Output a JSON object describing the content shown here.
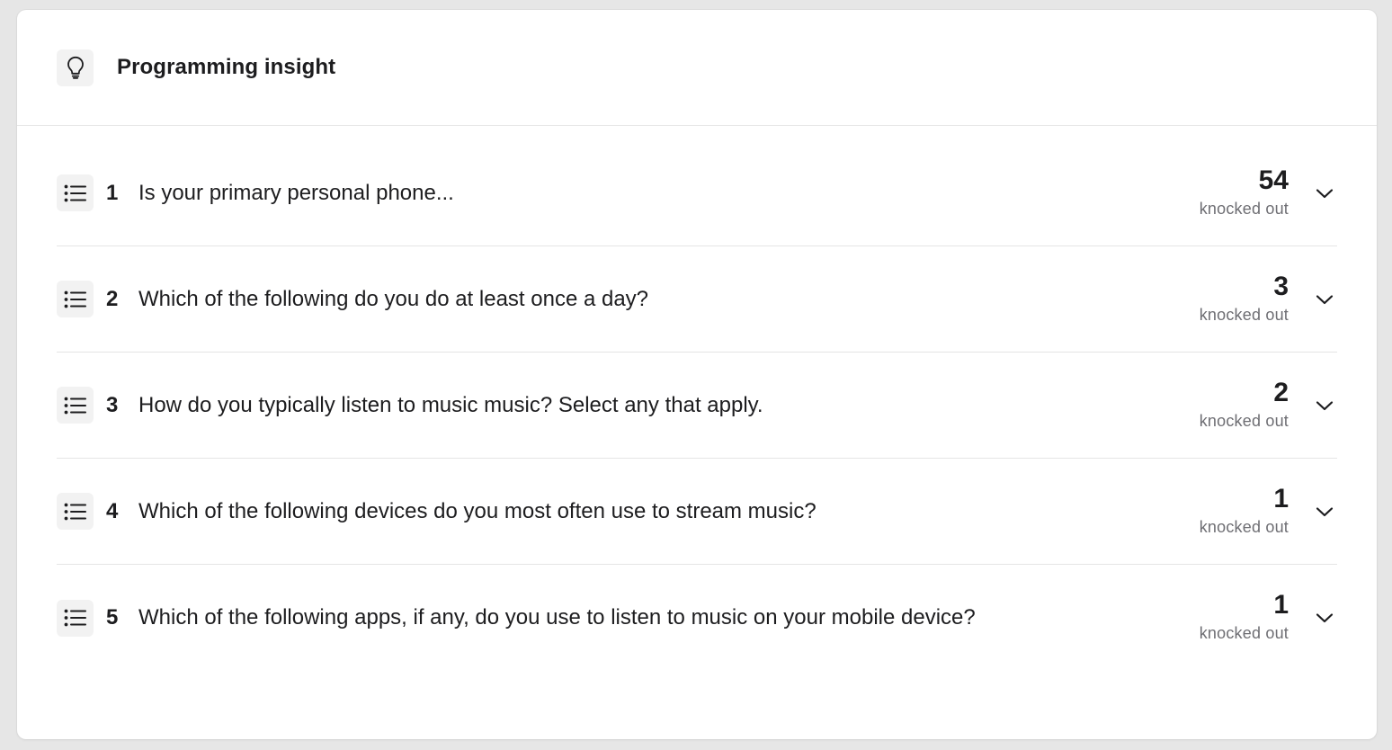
{
  "header": {
    "icon": "lightbulb-icon",
    "title": "Programming insight"
  },
  "questions": [
    {
      "number": "1",
      "text": "Is your primary personal phone...",
      "count": "54",
      "label": "knocked out",
      "icon": "list-icon"
    },
    {
      "number": "2",
      "text": "Which of the following do you do at least once a day?",
      "count": "3",
      "label": "knocked out",
      "icon": "list-icon"
    },
    {
      "number": "3",
      "text": "How do you typically listen to music music? Select any that apply.",
      "count": "2",
      "label": "knocked out",
      "icon": "list-icon"
    },
    {
      "number": "4",
      "text": "Which of the following devices do you most often use to stream music?",
      "count": "1",
      "label": "knocked out",
      "icon": "list-icon"
    },
    {
      "number": "5",
      "text": "Which of the following apps, if any, do you use to listen to music on your mobile device?",
      "count": "1",
      "label": "knocked out",
      "icon": "list-icon"
    }
  ],
  "colors": {
    "background": "#e6e6e6",
    "card": "#ffffff",
    "icon_tile": "#f2f2f2",
    "text": "#1d1d1f",
    "muted_text": "#6e6e73",
    "divider": "#e5e5e5"
  }
}
